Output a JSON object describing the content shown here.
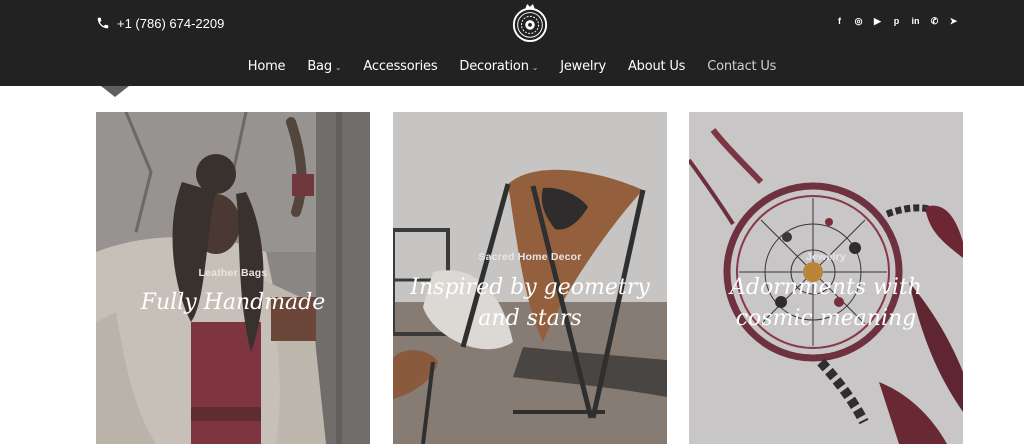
{
  "header": {
    "phone": "+1 (786) 674-2209",
    "logo_icon": "pomegranate-mandala-logo-icon",
    "socials": [
      {
        "name": "facebook-icon",
        "glyph": "f"
      },
      {
        "name": "instagram-icon",
        "glyph": "◎"
      },
      {
        "name": "youtube-icon",
        "glyph": "▶"
      },
      {
        "name": "pinterest-icon",
        "glyph": "p"
      },
      {
        "name": "linkedin-icon",
        "glyph": "in"
      },
      {
        "name": "whatsapp-icon",
        "glyph": "✆"
      },
      {
        "name": "telegram-icon",
        "glyph": "➤"
      }
    ]
  },
  "nav": {
    "items": [
      {
        "label": "Home"
      },
      {
        "label": "Bag"
      },
      {
        "label": "Accessories"
      },
      {
        "label": "Decoration"
      },
      {
        "label": "Jewelry"
      },
      {
        "label": "About Us"
      },
      {
        "label": "Contact Us"
      }
    ]
  },
  "cards": [
    {
      "kicker": "Leather Bags",
      "title": "Fully Handmade"
    },
    {
      "kicker": "Sacred Home Decor",
      "title_line1": "Inspired by geometry",
      "title_line2": "and stars"
    },
    {
      "kicker": "Jewelry",
      "title_line1": "Adornments with",
      "title_line2": "cosmic meaning"
    }
  ],
  "colors": {
    "header_bg": "#222222",
    "text_white": "#ffffff",
    "muted_nav": "#cfcfcf",
    "pointer": "#5f5f5f"
  }
}
